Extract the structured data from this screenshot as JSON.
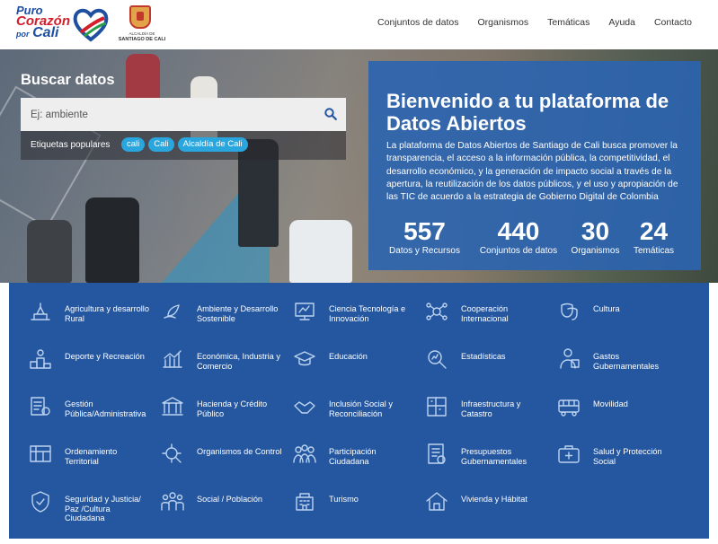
{
  "header": {
    "logo": {
      "puro": "Puro",
      "corazon": "Corazón",
      "por": "por",
      "cali": "Cali"
    },
    "alcaldia": {
      "line1": "ALCALDÍA DE",
      "line2": "SANTIAGO DE CALI"
    },
    "nav": [
      "Conjuntos de datos",
      "Organismos",
      "Temáticas",
      "Ayuda",
      "Contacto"
    ]
  },
  "search": {
    "title": "Buscar datos",
    "placeholder": "Ej: ambiente",
    "icon": "search-icon",
    "tags_label": "Etiquetas populares",
    "tags": [
      "cali",
      "Cali",
      "Alcaldía de Cali"
    ]
  },
  "welcome": {
    "title": "Bienvenido a tu plataforma de Datos Abiertos",
    "text": "La plataforma de Datos Abiertos de Santiago de Cali busca promover la transparencia, el acceso a la información pública, la competitividad, el desarrollo económico, y la generación de impacto social a través de la apertura, la reutilización de los datos públicos, y el uso y apropiación de las TIC de acuerdo a la estrategia de Gobierno Digital de Colombia",
    "stats": [
      {
        "value": "557",
        "label": "Datos y Recursos"
      },
      {
        "value": "440",
        "label": "Conjuntos de datos"
      },
      {
        "value": "30",
        "label": "Organismos"
      },
      {
        "value": "24",
        "label": "Temáticas"
      }
    ]
  },
  "categories": [
    {
      "label": "Agricultura y desarrollo Rural",
      "icon": "agriculture-icon"
    },
    {
      "label": "Ambiente y Desarrollo Sostenible",
      "icon": "environment-icon"
    },
    {
      "label": "Ciencia Tecnología e Innovación",
      "icon": "science-icon"
    },
    {
      "label": "Cooperación Internacional",
      "icon": "cooperation-icon"
    },
    {
      "label": "Cultura",
      "icon": "culture-icon"
    },
    {
      "label": "Deporte y Recreación",
      "icon": "sports-icon"
    },
    {
      "label": "Económica, Industria y Comercio",
      "icon": "economy-icon"
    },
    {
      "label": "Educación",
      "icon": "education-icon"
    },
    {
      "label": "Estadísticas",
      "icon": "statistics-icon"
    },
    {
      "label": "Gastos Gubernamentales",
      "icon": "government-spending-icon"
    },
    {
      "label": "Gestión Pública/Administrativa",
      "icon": "public-management-icon"
    },
    {
      "label": "Hacienda y Crédito Público",
      "icon": "treasury-icon"
    },
    {
      "label": "Inclusión Social y Reconciliación",
      "icon": "social-inclusion-icon"
    },
    {
      "label": "Infraestructura y Catastro",
      "icon": "infrastructure-icon"
    },
    {
      "label": "Movilidad",
      "icon": "mobility-icon"
    },
    {
      "label": "Ordenamiento Territorial",
      "icon": "territorial-icon"
    },
    {
      "label": "Organismos de Control",
      "icon": "control-icon"
    },
    {
      "label": "Participación Ciudadana",
      "icon": "participation-icon"
    },
    {
      "label": "Presupuestos Gubernamentales",
      "icon": "budget-icon"
    },
    {
      "label": "Salud y Protección Social",
      "icon": "health-icon"
    },
    {
      "label": "Seguridad y Justicia/ Paz /Cultura Ciudadana",
      "icon": "security-icon"
    },
    {
      "label": "Social / Población",
      "icon": "population-icon"
    },
    {
      "label": "Turismo",
      "icon": "tourism-icon"
    },
    {
      "label": "Vivienda y Hábitat",
      "icon": "housing-icon"
    }
  ]
}
